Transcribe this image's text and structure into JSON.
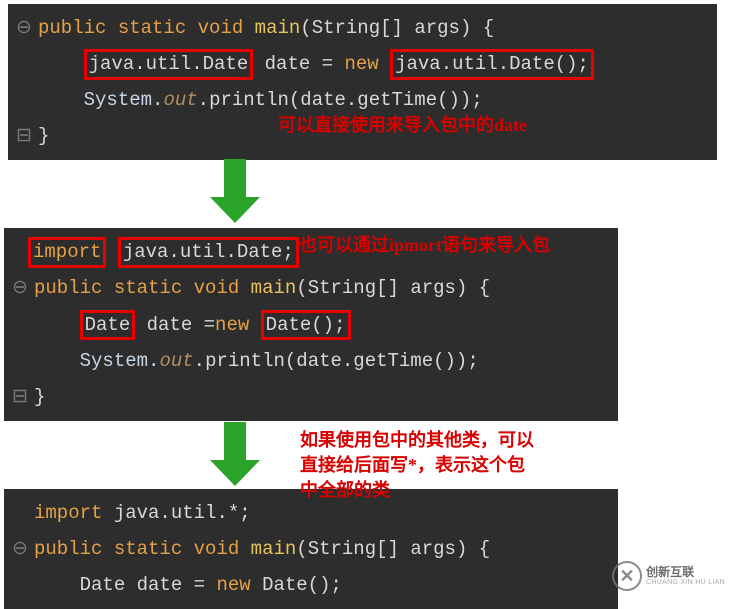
{
  "block1": {
    "line1": {
      "kw1": "public",
      "kw2": "static",
      "kw3": "void",
      "main": "main",
      "paren_open": "(",
      "string_type": "String",
      "brackets": "[]",
      "args": " args",
      "paren_close": ")",
      "brace": " {"
    },
    "line2": {
      "box1": "java.util.Date",
      "mid": " date = ",
      "new": "new",
      "sp": " ",
      "box2": "java.util.Date();"
    },
    "line3": {
      "sys": "System.",
      "out": "out",
      "dot": ".",
      "println": "println",
      "args": "(date.getTime());"
    },
    "line4": {
      "brace": "}"
    }
  },
  "note1": "可以直接使用来导入包中的date",
  "block2": {
    "line1": {
      "box1": "import",
      "sp": " ",
      "box2": "java.util.Date;"
    },
    "line2": {
      "kw1": "public",
      "kw2": "static",
      "kw3": "void",
      "main": "main",
      "paren_open": "(",
      "string_type": "String",
      "brackets": "[]",
      "args": " args",
      "paren_close": ")",
      "brace": " {"
    },
    "line3": {
      "box1": "Date",
      "mid": " date =",
      "new": "new",
      "sp": " ",
      "box2": "Date();"
    },
    "line4": {
      "sys": "System.",
      "out": "out",
      "dot": ".",
      "println": "println",
      "args": "(date.getTime());"
    },
    "line5": {
      "brace": "}"
    }
  },
  "note2": "也可以通过ipmort语句来导入包",
  "block3": {
    "line1": {
      "import": "import",
      "rest": " java.util.*;"
    },
    "line2": {
      "kw1": "public",
      "kw2": "static",
      "kw3": "void",
      "main": "main",
      "paren_open": "(",
      "string_type": "String",
      "brackets": "[]",
      "args": " args",
      "paren_close": ")",
      "brace": " {"
    },
    "line3": {
      "date1": "Date",
      "mid": " date = ",
      "new": "new",
      "sp": " ",
      "date2": "Date();"
    }
  },
  "note3": "如果使用包中的其他类，可以\n直接给后面写*，表示这个包\n中全部的类",
  "watermark": {
    "main": "创新互联",
    "sub": "CHUANG XIN HU LIAN"
  }
}
